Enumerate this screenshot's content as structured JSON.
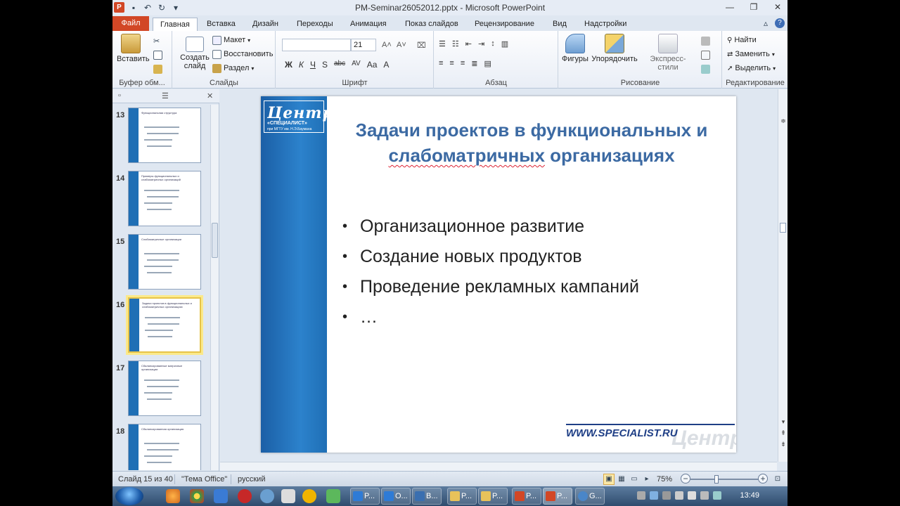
{
  "window": {
    "title": "PM-Seminar26052012.pptx - Microsoft PowerPoint",
    "app_icon_letter": "P",
    "undo_label": "↶",
    "save_label": "▪"
  },
  "ribbon_tabs": [
    "Файл",
    "Главная",
    "Вставка",
    "Дизайн",
    "Переходы",
    "Анимация",
    "Показ слайдов",
    "Рецензирование",
    "Вид",
    "Надстройки"
  ],
  "ribbon": {
    "clipboard": {
      "paste": "Вставить",
      "group": "Буфер обм..."
    },
    "slides": {
      "new_slide_line1": "Создать",
      "new_slide_line2": "слайд",
      "layout": "Макет",
      "reset": "Восстановить",
      "section": "Раздел",
      "group": "Слайды"
    },
    "font": {
      "font_name": "",
      "font_size": "21",
      "group": "Шрифт",
      "buttons": [
        "Ж",
        "К",
        "Ч",
        "S",
        "abc",
        "AV",
        "Aa",
        "A"
      ]
    },
    "paragraph": {
      "group": "Абзац"
    },
    "drawing": {
      "shapes": "Фигуры",
      "arrange": "Упорядочить",
      "styles": "Экспресс-стили",
      "group": "Рисование"
    },
    "editing": {
      "find": "Найти",
      "replace": "Заменить",
      "select": "Выделить",
      "group": "Редактирование"
    }
  },
  "left_panel": {
    "thumbnails": [
      {
        "num": "13",
        "title": "Функциональная структура"
      },
      {
        "num": "14",
        "title": "Примеры функциональных и слабоматричных организаций"
      },
      {
        "num": "15",
        "title": "Слабоматричные организации"
      },
      {
        "num": "16",
        "title": "Задачи проектов в функциональных и слабоматричных организациях",
        "selected": true
      },
      {
        "num": "17",
        "title": "Сбалансированные матричные организации"
      },
      {
        "num": "18",
        "title": "Сбалансированная организация"
      }
    ]
  },
  "slide": {
    "logo_main": "Центр",
    "logo_sub": "«СПЕЦИАЛИСТ»",
    "logo_tiny": "при МГТУ им. Н.Э.Баумана",
    "title_line1": "Задачи проектов в функциональных и",
    "title_line2_word1": "слабоматричных",
    "title_line2_word2": " организациях",
    "bullets": [
      "Организационное развитие",
      "Создание новых продуктов",
      "Проведение рекламных кампаний",
      "…"
    ],
    "footer_url": "WWW.SPECIALIST.RU",
    "watermark": "Центр"
  },
  "statusbar": {
    "slide_counter": "Слайд 15 из 40",
    "theme": "\"Тема Office\"",
    "language": "русский",
    "zoom": "75%"
  },
  "taskbar": {
    "tasks": [
      "P...",
      "O...",
      "B...",
      "P...",
      "P...",
      "P...",
      "P...",
      "G..."
    ],
    "clock": "13:49"
  },
  "colors": {
    "accent_blue": "#1f6fb5",
    "title_blue": "#3c6aa3",
    "file_tab": "#d24726"
  }
}
